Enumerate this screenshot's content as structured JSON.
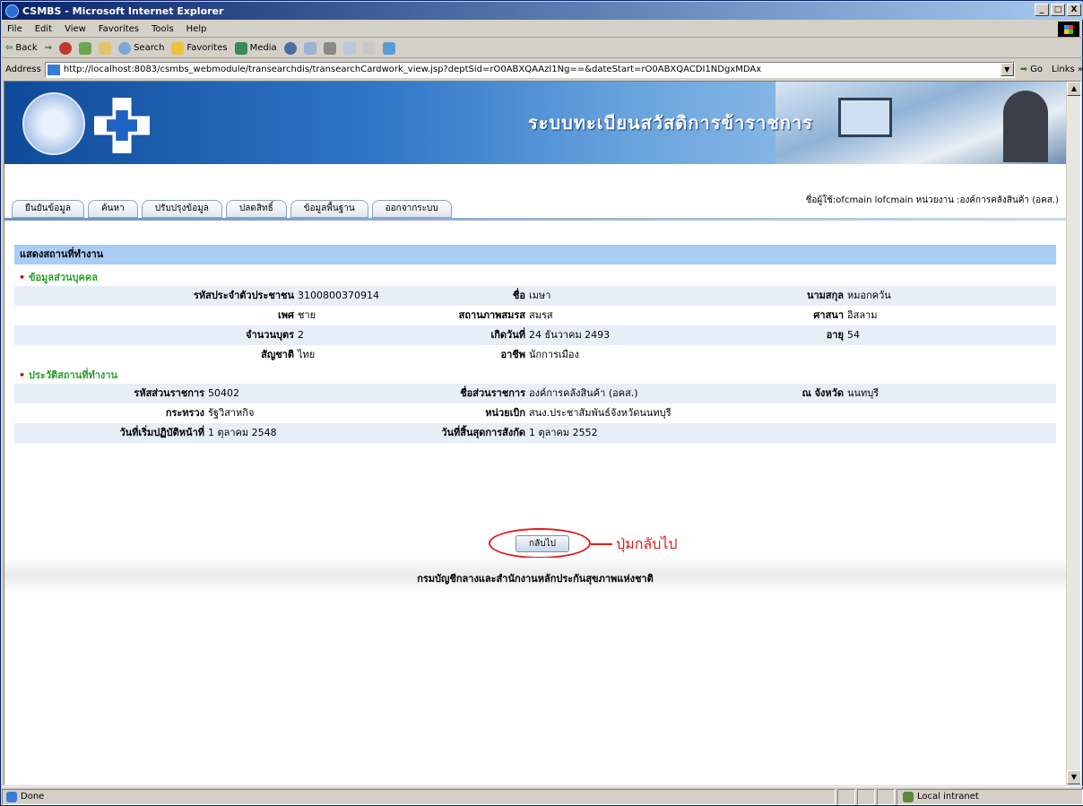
{
  "window": {
    "title": "CSMBS - Microsoft Internet Explorer",
    "minimize": "_",
    "maximize": "□",
    "close": "X"
  },
  "menu": [
    "File",
    "Edit",
    "View",
    "Favorites",
    "Tools",
    "Help"
  ],
  "toolbar": {
    "back": "Back",
    "forward": "→",
    "search": "Search",
    "favorites": "Favorites",
    "media": "Media"
  },
  "address": {
    "label": "Address",
    "url": "http://localhost:8083/csmbs_webmodule/transearchdis/transearchCardwork_view.jsp?deptSid=rO0ABXQAAzI1Ng==&dateStart=rO0ABXQACDI1NDgxMDAx",
    "go": "Go",
    "links": "Links »"
  },
  "banner": {
    "system_title": "ระบบทะเบียนสวัสดิการข้าราชการ"
  },
  "nav": {
    "tabs": [
      "ยืนยันข้อมูล",
      "ค้นหา",
      "ปรับปรุงข้อมูล",
      "ปลดสิทธิ์",
      "ข้อมูลพื้นฐาน",
      "ออกจากระบบ"
    ],
    "user_info": "ชื่อผู้ใช้:ofcmain lofcmain หน่วยงาน :องค์การคลังสินค้า (อคส.)"
  },
  "section": {
    "title": "แสดงสถานที่ทำงาน"
  },
  "personal": {
    "heading": "ข้อมูลส่วนบุคคล",
    "id_label": "รหัสประจำตัวประชาชน",
    "id_value": "3100800370914",
    "name_label": "ชื่อ",
    "name_value": "เมษา",
    "surname_label": "นามสกุล",
    "surname_value": "หมอกควัน",
    "sex_label": "เพศ",
    "sex_value": "ชาย",
    "marital_label": "สถานภาพสมรส",
    "marital_value": "สมรส",
    "religion_label": "ศาสนา",
    "religion_value": "อิสลาม",
    "children_label": "จำนวนบุตร",
    "children_value": "2",
    "birth_label": "เกิดวันที่",
    "birth_value": "24 ธันวาคม 2493",
    "age_label": "อายุ",
    "age_value": "54",
    "nationality_label": "สัญชาติ",
    "nationality_value": "ไทย",
    "occupation_label": "อาชีพ",
    "occupation_value": "นักการเมือง"
  },
  "work": {
    "heading": "ประวัติสถานที่ทำงาน",
    "dept_code_label": "รหัสส่วนราชการ",
    "dept_code_value": "50402",
    "dept_name_label": "ชื่อส่วนราชการ",
    "dept_name_value": "องค์การคลังสินค้า (อคส.)",
    "province_label": "ณ จังหวัด",
    "province_value": "นนทบุรี",
    "ministry_label": "กระทรวง",
    "ministry_value": "รัฐวิสาหกิจ",
    "unit_label": "หน่วยเบิก",
    "unit_value": "สนง.ประชาสัมพันธ์จังหวัดนนทบุรี",
    "start_label": "วันที่เริ่มปฏิบัติหน้าที่",
    "start_value": "1 ตุลาคม 2548",
    "end_label": "วันที่สิ้นสุดการสังกัด",
    "end_value": "1 ตุลาคม 2552"
  },
  "back": {
    "button": "กลับไป",
    "annotation": "ปุ่มกลับไป"
  },
  "footer": {
    "text": "กรมบัญชีกลางและสำนักงานหลักประกันสุขภาพแห่งชาติ"
  },
  "status": {
    "text": "Done",
    "zone": "Local intranet"
  }
}
